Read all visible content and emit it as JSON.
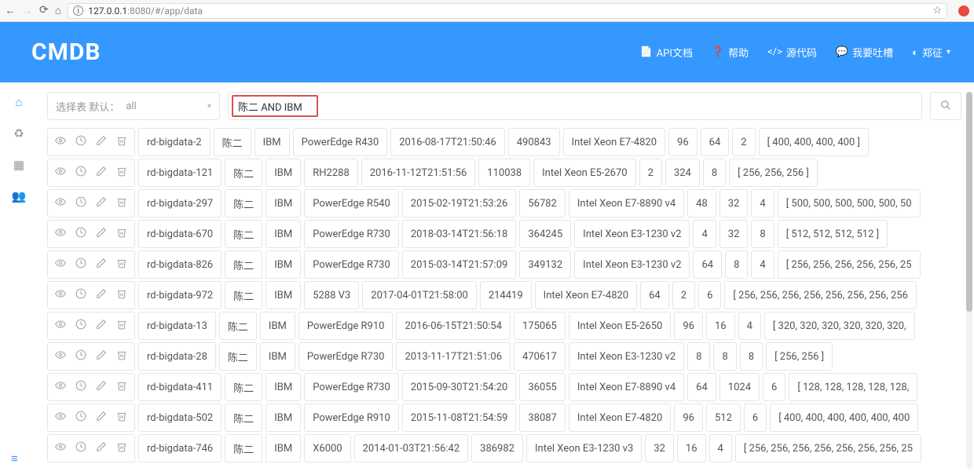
{
  "browser": {
    "url_host": "127.0.0.1",
    "url_rest": ":8080/#/app/data"
  },
  "header": {
    "logo": "CMDB",
    "menu": {
      "api_doc": "API文档",
      "help": "帮助",
      "source": "源代码",
      "feedback": "我要吐槽",
      "user": "郑征"
    }
  },
  "query": {
    "select_label": "选择表 默认：",
    "select_value": "all",
    "input_value": "陈二 AND IBM"
  },
  "rows": [
    {
      "host": "rd-bigdata-2",
      "owner": "陈二",
      "vendor": "IBM",
      "model": "PowerEdge R430",
      "time": "2016-08-17T21:50:46",
      "num": "490843",
      "cpu": "Intel Xeon E7-4820",
      "a": "96",
      "b": "64",
      "c": "2",
      "arr": "[ 400, 400, 400, 400 ]"
    },
    {
      "host": "rd-bigdata-121",
      "owner": "陈二",
      "vendor": "IBM",
      "model": "RH2288",
      "time": "2016-11-12T21:51:56",
      "num": "110038",
      "cpu": "Intel Xeon E5-2670",
      "a": "2",
      "b": "324",
      "c": "8",
      "arr": "[ 256, 256, 256 ]"
    },
    {
      "host": "rd-bigdata-297",
      "owner": "陈二",
      "vendor": "IBM",
      "model": "PowerEdge R540",
      "time": "2015-02-19T21:53:26",
      "num": "56782",
      "cpu": "Intel Xeon E7-8890 v4",
      "a": "48",
      "b": "32",
      "c": "4",
      "arr": "[ 500, 500, 500, 500, 500, 50"
    },
    {
      "host": "rd-bigdata-670",
      "owner": "陈二",
      "vendor": "IBM",
      "model": "PowerEdge R730",
      "time": "2018-03-14T21:56:18",
      "num": "364245",
      "cpu": "Intel Xeon E3-1230 v2",
      "a": "4",
      "b": "32",
      "c": "8",
      "arr": "[ 512, 512, 512, 512 ]"
    },
    {
      "host": "rd-bigdata-826",
      "owner": "陈二",
      "vendor": "IBM",
      "model": "PowerEdge R730",
      "time": "2015-03-14T21:57:09",
      "num": "349132",
      "cpu": "Intel Xeon E3-1230 v2",
      "a": "64",
      "b": "8",
      "c": "4",
      "arr": "[ 256, 256, 256, 256, 256, 25"
    },
    {
      "host": "rd-bigdata-972",
      "owner": "陈二",
      "vendor": "IBM",
      "model": "5288 V3",
      "time": "2017-04-01T21:58:00",
      "num": "214419",
      "cpu": "Intel Xeon E7-4820",
      "a": "64",
      "b": "2",
      "c": "6",
      "arr": "[ 256, 256, 256, 256, 256, 256, 256, 256"
    },
    {
      "host": "rd-bigdata-13",
      "owner": "陈二",
      "vendor": "IBM",
      "model": "PowerEdge R910",
      "time": "2016-06-15T21:50:54",
      "num": "175065",
      "cpu": "Intel Xeon E5-2650",
      "a": "96",
      "b": "16",
      "c": "4",
      "arr": "[ 320, 320, 320, 320, 320, 320,"
    },
    {
      "host": "rd-bigdata-28",
      "owner": "陈二",
      "vendor": "IBM",
      "model": "PowerEdge R730",
      "time": "2013-11-17T21:51:06",
      "num": "470617",
      "cpu": "Intel Xeon E3-1230 v2",
      "a": "8",
      "b": "8",
      "c": "8",
      "arr": "[ 256, 256 ]"
    },
    {
      "host": "rd-bigdata-411",
      "owner": "陈二",
      "vendor": "IBM",
      "model": "PowerEdge R730",
      "time": "2015-09-30T21:54:20",
      "num": "36055",
      "cpu": "Intel Xeon E7-8890 v4",
      "a": "64",
      "b": "1024",
      "c": "6",
      "arr": "[ 128, 128, 128, 128, 128,"
    },
    {
      "host": "rd-bigdata-502",
      "owner": "陈二",
      "vendor": "IBM",
      "model": "PowerEdge R910",
      "time": "2015-11-08T21:54:59",
      "num": "38087",
      "cpu": "Intel Xeon E7-4820",
      "a": "96",
      "b": "512",
      "c": "6",
      "arr": "[ 400, 400, 400, 400, 400, 400"
    },
    {
      "host": "rd-bigdata-746",
      "owner": "陈二",
      "vendor": "IBM",
      "model": "X6000",
      "time": "2014-01-03T21:56:42",
      "num": "386982",
      "cpu": "Intel Xeon E3-1230 v3",
      "a": "32",
      "b": "16",
      "c": "4",
      "arr": "[ 256, 256, 256, 256, 256, 256, 256, 25"
    }
  ]
}
